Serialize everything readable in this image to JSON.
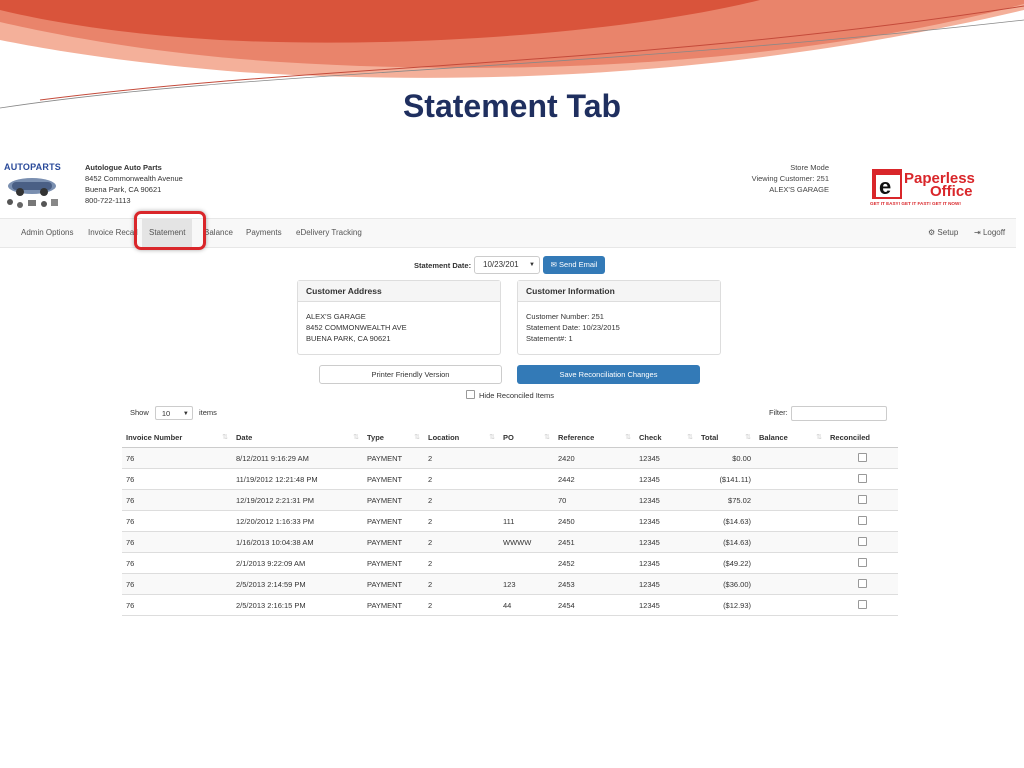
{
  "slide_title": "Statement Tab",
  "header": {
    "logo_text": "AUTOPARTS",
    "company_name": "Autologue Auto Parts",
    "address1": "8452 Commonwealth Avenue",
    "address2": "Buena Park, CA 90621",
    "phone": "800-722-1113",
    "store_mode": "Store Mode",
    "viewing_customer": "Viewing Customer: 251",
    "customer_name": "ALEX'S GARAGE",
    "brand_logo": {
      "line1": "Paperless",
      "line2": "Office",
      "tagline": "GET IT EASY! GET IT FAST! GET IT NOW!"
    }
  },
  "nav": {
    "items": [
      "Admin Options",
      "Invoice Recall",
      "Statement",
      "Balance",
      "Payments",
      "eDelivery Tracking"
    ],
    "setup": "Setup",
    "logoff": "Logoff"
  },
  "statement": {
    "date_label": "Statement Date:",
    "date_value": "10/23/201",
    "send_email": "Send Email"
  },
  "customer_address": {
    "title": "Customer Address",
    "lines": [
      "ALEX'S GARAGE",
      "8452 COMMONWEALTH AVE",
      "BUENA PARK, CA 90621"
    ]
  },
  "customer_info": {
    "title": "Customer Information",
    "lines": [
      "Customer Number: 251",
      "Statement Date: 10/23/2015",
      "Statement#: 1"
    ]
  },
  "actions": {
    "printer": "Printer Friendly Version",
    "save": "Save Reconciliation Changes",
    "hide_reconciled": "Hide Reconciled Items"
  },
  "table_controls": {
    "show": "Show",
    "page_size": "10",
    "items": "items",
    "filter": "Filter:"
  },
  "table": {
    "columns": [
      "Invoice Number",
      "Date",
      "Type",
      "Location",
      "PO",
      "Reference",
      "Check",
      "Total",
      "Balance",
      "Reconciled"
    ],
    "rows": [
      [
        "76",
        "8/12/2011 9:16:29 AM",
        "PAYMENT",
        "2",
        "",
        "2420",
        "12345",
        "$0.00",
        ""
      ],
      [
        "76",
        "11/19/2012 12:21:48 PM",
        "PAYMENT",
        "2",
        "",
        "2442",
        "12345",
        "($141.11)",
        ""
      ],
      [
        "76",
        "12/19/2012 2:21:31 PM",
        "PAYMENT",
        "2",
        "",
        "70",
        "12345",
        "$75.02",
        ""
      ],
      [
        "76",
        "12/20/2012 1:16:33 PM",
        "PAYMENT",
        "2",
        "111",
        "2450",
        "12345",
        "($14.63)",
        ""
      ],
      [
        "76",
        "1/16/2013 10:04:38 AM",
        "PAYMENT",
        "2",
        "WWWW",
        "2451",
        "12345",
        "($14.63)",
        ""
      ],
      [
        "76",
        "2/1/2013 9:22:09 AM",
        "PAYMENT",
        "2",
        "",
        "2452",
        "12345",
        "($49.22)",
        ""
      ],
      [
        "76",
        "2/5/2013 2:14:59 PM",
        "PAYMENT",
        "2",
        "123",
        "2453",
        "12345",
        "($36.00)",
        ""
      ],
      [
        "76",
        "2/5/2013 2:16:15 PM",
        "PAYMENT",
        "2",
        "44",
        "2454",
        "12345",
        "($12.93)",
        ""
      ]
    ]
  },
  "colors": {
    "primary": "#337ab7",
    "highlight": "#d9262a",
    "title": "#1f2f5f",
    "deco_red": "#e8604a"
  }
}
